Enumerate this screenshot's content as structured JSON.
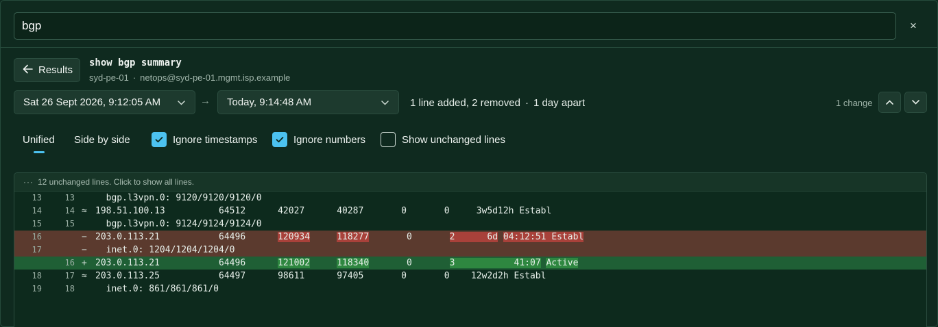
{
  "search": {
    "value": "bgp",
    "close_symbol": "×"
  },
  "header": {
    "back_label": "Results",
    "command": "show bgp summary",
    "device": "syd-pe-01",
    "meta_separator": "·",
    "connection": "netops@syd-pe-01.mgmt.isp.example"
  },
  "compare": {
    "from": "Sat 26 Sept 2026, 9:12:05 AM",
    "to": "Today, 9:14:48 AM",
    "arrow": "→",
    "summary_changes": "1 line added, 2 removed",
    "summary_separator": "·",
    "summary_age": "1 day apart",
    "change_count": "1 change"
  },
  "options": {
    "tabs": [
      {
        "label": "Unified",
        "active": true
      },
      {
        "label": "Side by side",
        "active": false
      }
    ],
    "ignore_timestamps": {
      "label": "Ignore timestamps",
      "checked": true
    },
    "ignore_numbers": {
      "label": "Ignore numbers",
      "checked": true
    },
    "show_unchanged": {
      "label": "Show unchanged lines",
      "checked": false
    }
  },
  "diff": {
    "collapsed_label": "12 unchanged lines. Click to show all lines.",
    "lines": [
      {
        "type": "same",
        "old": "13",
        "new": "13",
        "marker": "",
        "segments": [
          {
            "t": "  bgp.l3vpn.0: 9120/9120/9120/0"
          }
        ]
      },
      {
        "type": "same",
        "old": "14",
        "new": "14",
        "marker": "≈",
        "segments": [
          {
            "t": "198.51.100.13          64512      42027      40287       0       0     3w5d12h Establ"
          }
        ]
      },
      {
        "type": "same",
        "old": "15",
        "new": "15",
        "marker": "",
        "segments": [
          {
            "t": "  bgp.l3vpn.0: 9124/9124/9124/0"
          }
        ]
      },
      {
        "type": "del",
        "old": "16",
        "new": "",
        "marker": "−",
        "segments": [
          {
            "t": "203.0.113.21           64496      "
          },
          {
            "t": "120934",
            "h": true
          },
          {
            "t": "     "
          },
          {
            "t": "118277",
            "h": true
          },
          {
            "t": "       0       "
          },
          {
            "t": "2      6d",
            "h": true
          },
          {
            "t": " "
          },
          {
            "t": "04:12:51 Establ",
            "h": true
          }
        ]
      },
      {
        "type": "del",
        "old": "17",
        "new": "",
        "marker": "−",
        "segments": [
          {
            "t": "  inet.0: 1204/1204/1204/0"
          }
        ]
      },
      {
        "type": "add",
        "old": "",
        "new": "16",
        "marker": "+",
        "segments": [
          {
            "t": "203.0.113.21           64496      "
          },
          {
            "t": "121002",
            "h": true
          },
          {
            "t": "     "
          },
          {
            "t": "118340",
            "h": true
          },
          {
            "t": "       0       "
          },
          {
            "t": "3           41:07",
            "h": true
          },
          {
            "t": " "
          },
          {
            "t": "Active",
            "h": true
          }
        ]
      },
      {
        "type": "same",
        "old": "18",
        "new": "17",
        "marker": "≈",
        "segments": [
          {
            "t": "203.0.113.25           64497      98611      97405       0       0    12w2d2h Establ"
          }
        ]
      },
      {
        "type": "same",
        "old": "19",
        "new": "18",
        "marker": "",
        "segments": [
          {
            "t": "  inet.0: 861/861/861/0"
          }
        ]
      }
    ]
  }
}
